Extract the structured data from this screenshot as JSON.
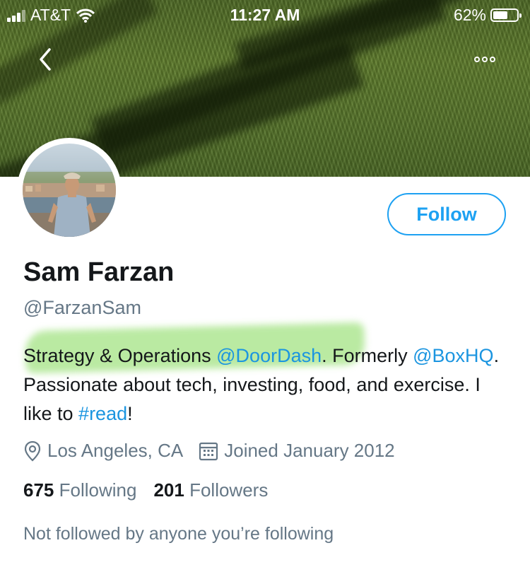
{
  "status_bar": {
    "carrier": "AT&T",
    "time": "11:27 AM",
    "battery_percent": "62%",
    "battery_level": 0.62,
    "signal_icon": "signal-bars-icon",
    "wifi_icon": "wifi-icon"
  },
  "nav": {
    "back_icon": "chevron-left-icon",
    "more_icon": "more-options-icon"
  },
  "profile": {
    "name": "Sam Farzan",
    "handle": "@FarzanSam",
    "follow_label": "Follow",
    "bio": {
      "part1": "Strategy & Operations ",
      "mention1": "@DoorDash",
      "part2": ". Formerly ",
      "mention2": "@BoxHQ",
      "part3": ". Passionate about tech, investing, food, and exercise. I like to ",
      "hashtag": "#read",
      "part4": "!"
    },
    "location": "Los Angeles, CA",
    "joined": "Joined January 2012",
    "following_count": "675",
    "following_label": "Following",
    "followers_count": "201",
    "followers_label": "Followers",
    "not_followed_text": "Not followed by anyone you’re following"
  },
  "colors": {
    "accent": "#1da1f2",
    "link": "#1b95e0",
    "secondary_text": "#657786",
    "highlight": "#8cdc64"
  }
}
